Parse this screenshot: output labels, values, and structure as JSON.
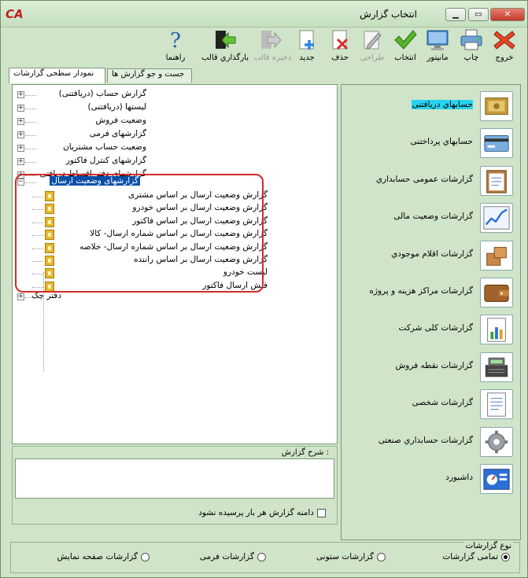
{
  "window": {
    "title": "انتخاب گزارش",
    "logo": "CA"
  },
  "toolbar": [
    {
      "name": "exit",
      "label": "خروج",
      "icon": "close-x-icon",
      "enabled": true
    },
    {
      "name": "print",
      "label": "چاپ",
      "icon": "printer-icon",
      "enabled": true
    },
    {
      "name": "monitor",
      "label": "مانیتور",
      "icon": "monitor-icon",
      "enabled": true
    },
    {
      "name": "select",
      "label": "انتخاب",
      "icon": "checkmark-icon",
      "enabled": true
    },
    {
      "name": "design",
      "label": "طراحی",
      "icon": "pencil-icon",
      "enabled": false
    },
    {
      "name": "delete",
      "label": "حذف",
      "icon": "delete-doc-icon",
      "enabled": true
    },
    {
      "name": "new",
      "label": "جدید",
      "icon": "new-doc-icon",
      "enabled": true
    },
    {
      "name": "save-template",
      "label": "ذخیره قالب",
      "icon": "export-icon",
      "enabled": false
    },
    {
      "name": "load-template",
      "label": "بارگذاري قالب",
      "icon": "import-icon",
      "enabled": true
    },
    {
      "name": "help",
      "label": "راهنما",
      "icon": "question-icon",
      "enabled": true
    }
  ],
  "tabs": [
    {
      "label": "نمودار سطحی گزارشات",
      "active": true
    },
    {
      "label": "جست و جو گزارش ها",
      "active": false
    }
  ],
  "tree": {
    "top": [
      {
        "label": "گزارش حساب (دریافتنی)",
        "expander": "+"
      },
      {
        "label": "لیستها (دریافتنی)",
        "expander": "+"
      },
      {
        "label": "وضعیت فروش",
        "expander": "+"
      },
      {
        "label": "گزارشهای فرمی",
        "expander": "+"
      },
      {
        "label": "وضعیت حساب مشتریان",
        "expander": "+"
      },
      {
        "label": "گزارشهای کنترل فاکتور",
        "expander": "+"
      },
      {
        "label": "گزارشهای دفتر اقساط دریافتی",
        "expander": "+"
      }
    ],
    "expanded": {
      "label": "گزارشهای وضعیت ارسال",
      "expander": "−"
    },
    "children": [
      "گزارش وضعیت ارسال بر اساس  مشتری",
      "گزارش وضعیت ارسال بر اساس  خودرو",
      "گزارش وضعیت ارسال بر اساس  فاکتور",
      "گزارش وضعیت ارسال بر اساس شماره ارسال- کالا",
      "گزارش وضعیت ارسال بر اساس شماره ارسال- خلاصه",
      "گزارش وضعیت ارسال بر اساس  راننده",
      "لیست خودرو",
      "فیش ارسال فاکتور"
    ],
    "last": {
      "label": "دفتر چک",
      "expander": "+"
    }
  },
  "description": {
    "label": "شرح گزارش :",
    "text": ""
  },
  "checkbox": {
    "label": "دامنه گزارش هر بار پرسیده نشود",
    "checked": false
  },
  "categories": [
    {
      "label": "حسابهاي دریافتنی",
      "icon": "money-icon",
      "selected": true
    },
    {
      "label": "حسابهاي پرداختنی",
      "icon": "card-icon",
      "selected": false
    },
    {
      "label": "گزارشات عمومی حسابداري",
      "icon": "clipboard-icon",
      "selected": false
    },
    {
      "label": "گزارشات وضعیت مالی",
      "icon": "line-chart-icon",
      "selected": false
    },
    {
      "label": "گزارشات اقلام موجودي",
      "icon": "boxes-icon",
      "selected": false
    },
    {
      "label": "گزارشات مراکز هزینه و پروژه",
      "icon": "wallet-icon",
      "selected": false
    },
    {
      "label": "گزارشات کلی شرکت",
      "icon": "report-chart-icon",
      "selected": false
    },
    {
      "label": "گزارشات نقطه فروش",
      "icon": "cash-register-icon",
      "selected": false
    },
    {
      "label": "گزارشات شخصی",
      "icon": "document-icon",
      "selected": false
    },
    {
      "label": "گزارشات حسابداري صنعتی",
      "icon": "gear-icon",
      "selected": false
    },
    {
      "label": "داشبورد",
      "icon": "dashboard-icon",
      "selected": false
    }
  ],
  "report_type": {
    "label": "نوع گزارشات",
    "options": [
      {
        "label": "تمامی گزارشات",
        "checked": true
      },
      {
        "label": "گزارشات ستونی",
        "checked": false
      },
      {
        "label": "گزارشات فرمی",
        "checked": false
      },
      {
        "label": "گزارشات صفحه نمایش",
        "checked": false
      }
    ]
  }
}
